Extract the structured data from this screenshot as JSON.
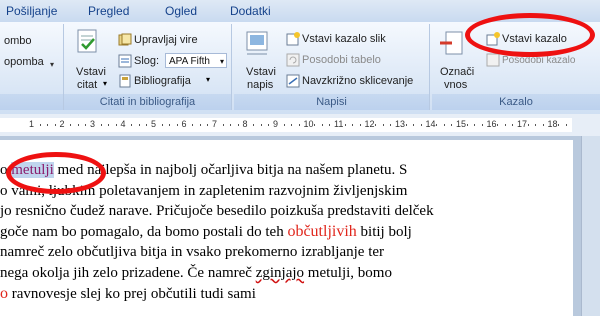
{
  "tabs": [
    "Pošiljanje",
    "Pregled",
    "Ogled",
    "Dodatki"
  ],
  "ribbon": {
    "group_left_partial": {
      "line1": "ombo",
      "line2": "opomba"
    },
    "citations": {
      "insert_citation": [
        "Vstavi",
        "citat"
      ],
      "manage_sources": "Upravljaj vire",
      "style_label": "Slog:",
      "style_value": "APA Fifth",
      "bibliography": "Bibliografija",
      "group_label": "Citati in bibliografija"
    },
    "captions": {
      "insert_caption": [
        "Vstavi",
        "napis"
      ],
      "insert_table_of_figures": "Vstavi kazalo slik",
      "update_table": "Posodobi tabelo",
      "cross_reference": "Navzkrižno sklicevanje",
      "group_label": "Napisi"
    },
    "index": {
      "mark_entry": [
        "Označi",
        "vnos"
      ],
      "insert_index": "Vstavi kazalo",
      "update_index": "Posodobi kazalo",
      "group_label": "Kazalo"
    }
  },
  "ruler": {
    "numbers": [
      "1",
      "2",
      "3",
      "4",
      "5",
      "6",
      "7",
      "8",
      "9",
      "10",
      "11",
      "12",
      "13",
      "14",
      "15",
      "16",
      "17",
      "18"
    ]
  },
  "document": {
    "line1": {
      "pre": "o ",
      "hl": "metulji",
      "post": " med najlepša in najbolj očarljiva bitja na našem planetu. S"
    },
    "line2": "o vami, ljubkim poletavanjem in zapletenim razvojnim življenjskim",
    "line3": "jo resnično čudež narave. Pričujoče besedilo poizkuša predstaviti delček",
    "line4": {
      "pre": "goče nam bo pomagalo, da bomo postali do teh ",
      "red": "občutljivih",
      "post": " bitij bolj"
    },
    "line5": "namreč zelo občutljiva bitja in vsako prekomerno izrabljanje ter",
    "line6": {
      "pre": "nega okolja jih zelo prizadene. Če namreč ",
      "squig": "zginjajo",
      "post": " metulji, bomo"
    },
    "line7": {
      "red": "o",
      "post": " ravnovesje slej ko prej občutili tudi sami"
    }
  },
  "colors": {
    "accent_red": "#ee1111",
    "ribbon_text": "#15428b"
  }
}
